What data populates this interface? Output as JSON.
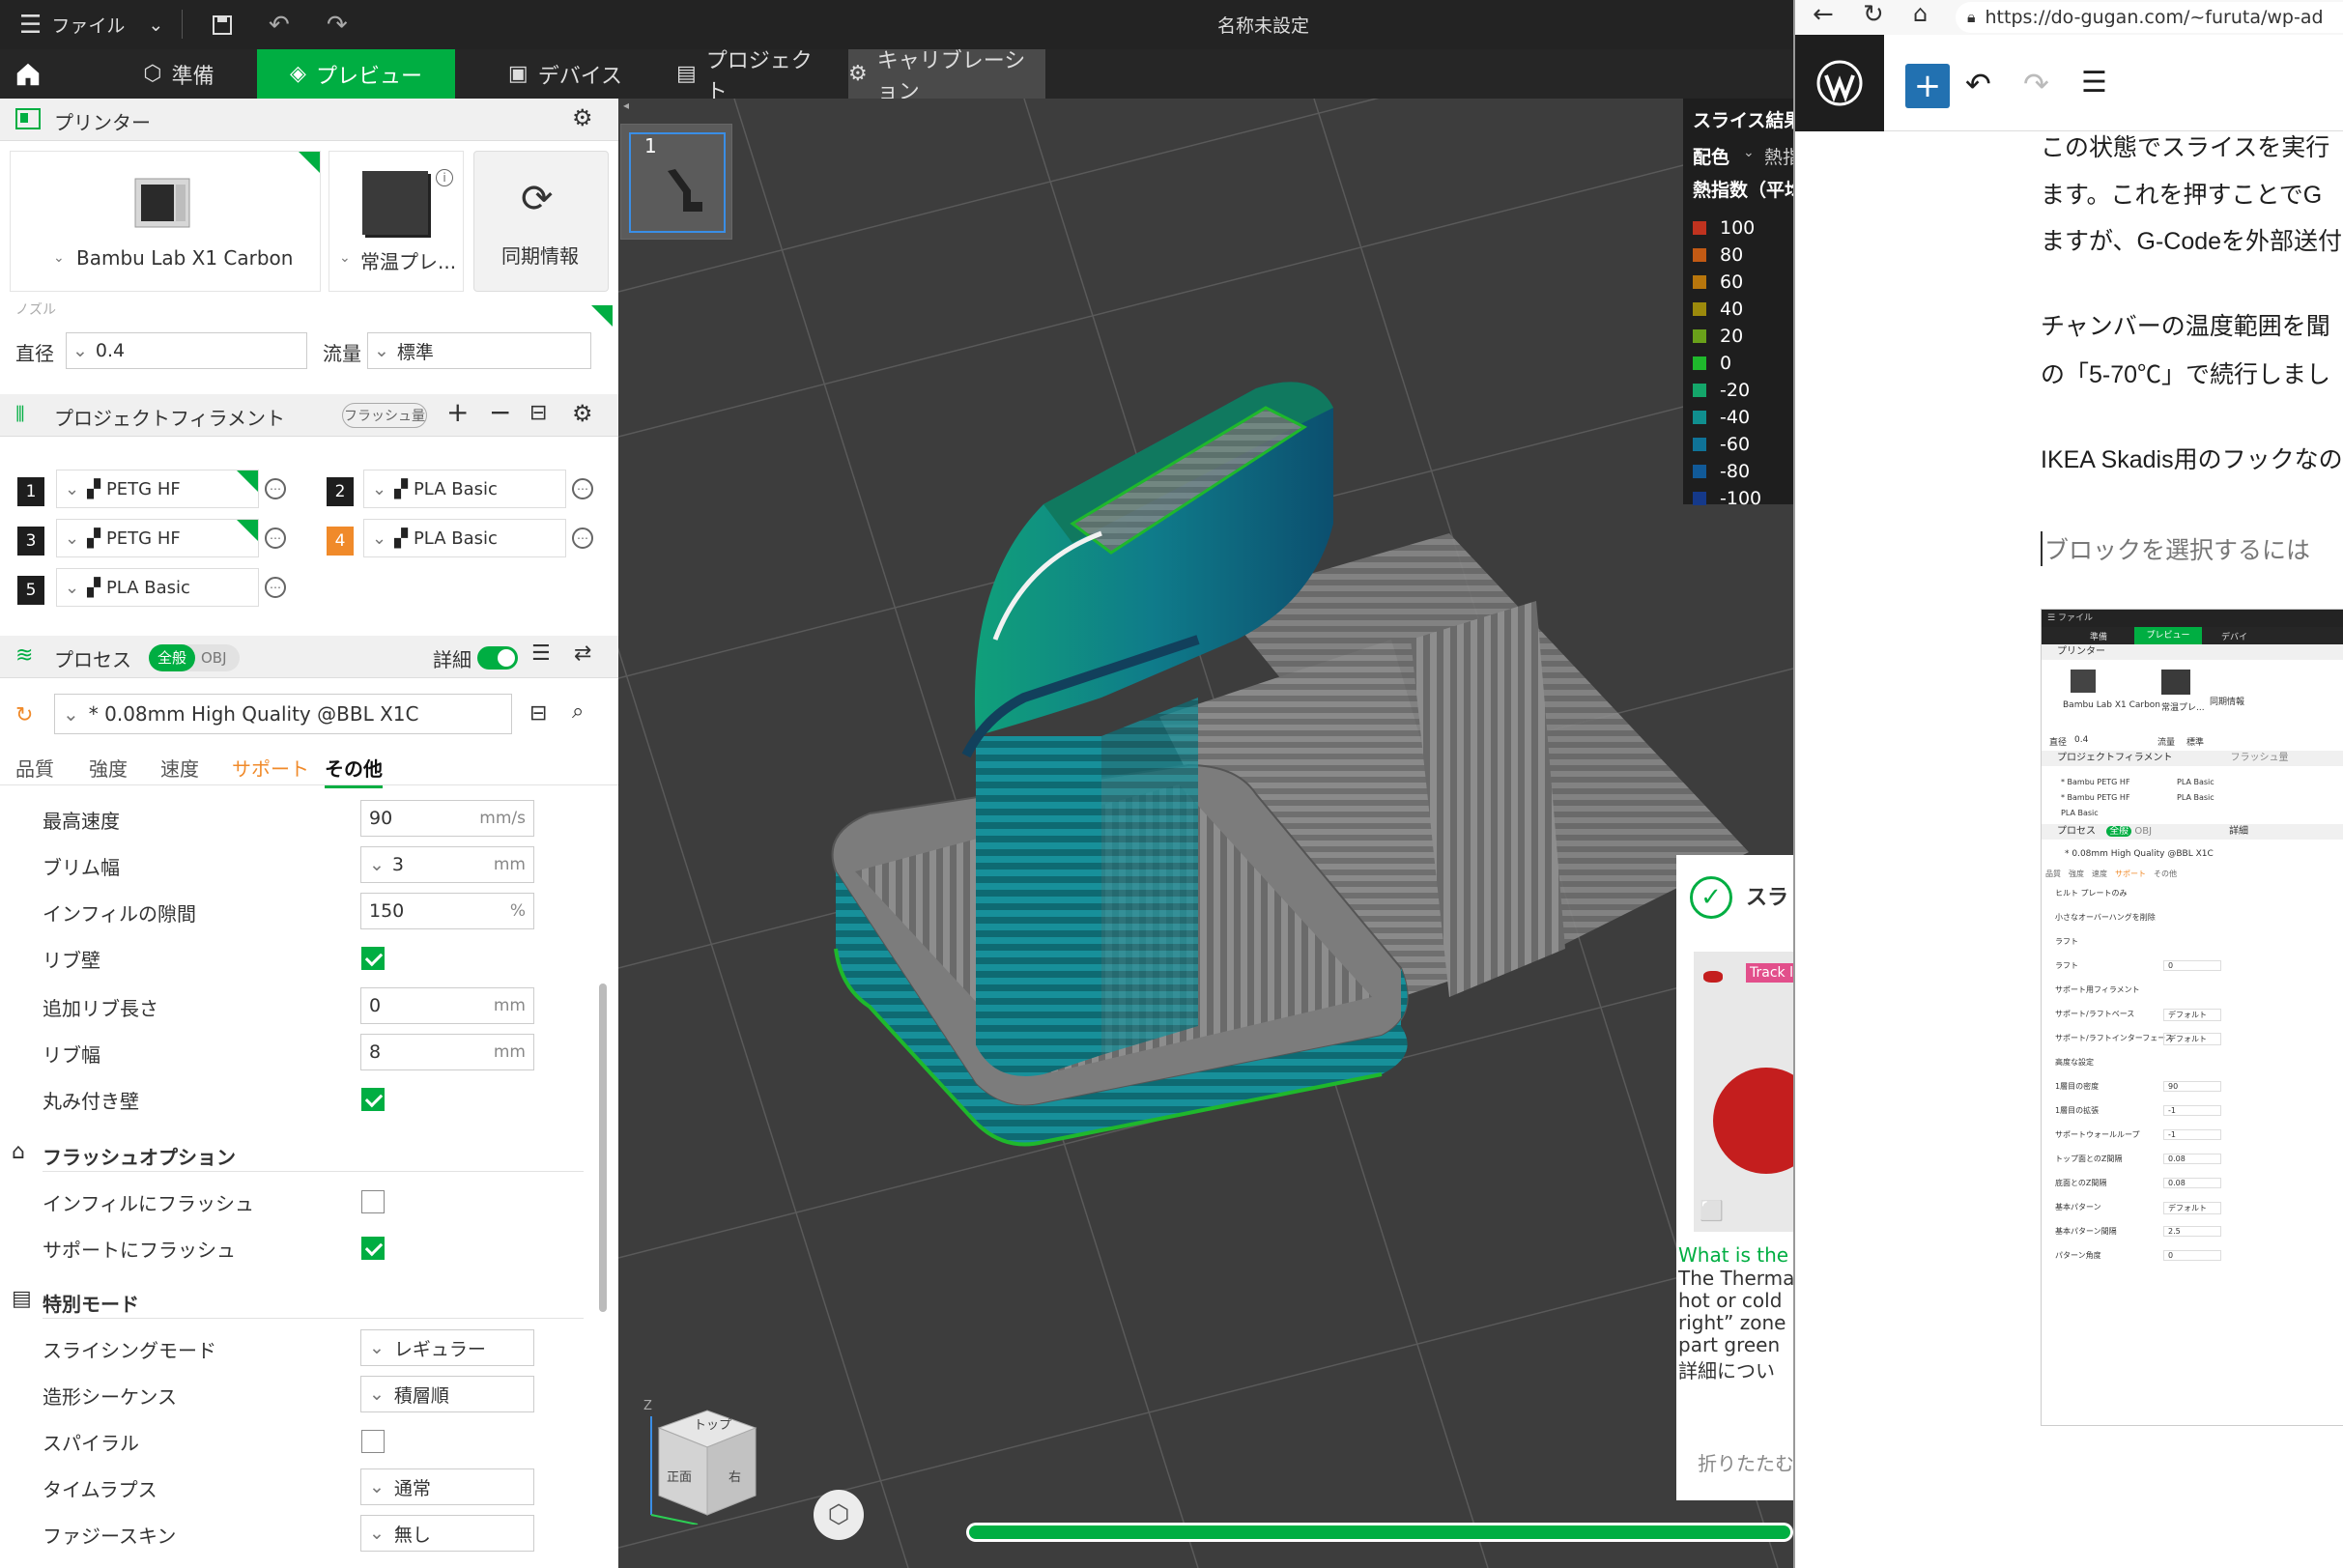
{
  "titlebar": {
    "menu_label": "ファイル",
    "window_title": "名称未設定"
  },
  "tabs": [
    {
      "label": "準備"
    },
    {
      "label": "プレビュー"
    },
    {
      "label": "デバイス"
    },
    {
      "label": "プロジェクト"
    },
    {
      "label": "キャリブレーション"
    }
  ],
  "printer": {
    "section_title": "プリンター",
    "printer_name": "Bambu Lab X1 Carbon",
    "plate_name": "常温プレ...",
    "sync_label": "同期情報",
    "nozzle_group": "ノズル",
    "diameter_label": "直径",
    "diameter_value": "0.4",
    "flow_label": "流量",
    "flow_value": "標準"
  },
  "filament": {
    "section_title": "プロジェクトフィラメント",
    "flush_label": "フラッシュ量",
    "items": [
      {
        "num": "1",
        "name": "PETG HF",
        "color": "#1e1e1e"
      },
      {
        "num": "2",
        "name": "PLA Basic",
        "color": "#1e1e1e"
      },
      {
        "num": "3",
        "name": "PETG HF",
        "color": "#1e1e1e"
      },
      {
        "num": "4",
        "name": "PLA Basic",
        "color": "#f08a2a"
      },
      {
        "num": "5",
        "name": "PLA Basic",
        "color": "#1e1e1e"
      }
    ]
  },
  "process": {
    "section_title": "プロセス",
    "toggle_all": "全般",
    "toggle_obj": "OBJ",
    "detail_label": "詳細",
    "preset": "* 0.08mm High Quality @BBL X1C",
    "subtabs": [
      "品質",
      "強度",
      "速度",
      "サポート",
      "その他"
    ],
    "fields": [
      {
        "label": "最高速度",
        "value": "90",
        "unit": "mm/s"
      },
      {
        "label": "ブリム幅",
        "value": "3",
        "unit": "mm"
      },
      {
        "label": "インフィルの隙間",
        "value": "150",
        "unit": "%"
      },
      {
        "label": "リブ壁"
      },
      {
        "label": "追加リブ長さ",
        "value": "0",
        "unit": "mm"
      },
      {
        "label": "リブ幅",
        "value": "8",
        "unit": "mm"
      },
      {
        "label": "丸み付き壁"
      }
    ],
    "flush_group": "フラッシュオプション",
    "flush_infill": "インフィルにフラッシュ",
    "flush_support": "サポートにフラッシュ",
    "special_group": "特別モード",
    "slicing_mode_label": "スライシングモード",
    "slicing_mode_value": "レギュラー",
    "sequence_label": "造形シーケンス",
    "sequence_value": "積層順",
    "spiral_label": "スパイラル",
    "timelapse_label": "タイムラプス",
    "timelapse_value": "通常",
    "fuzzy_label": "ファジースキン",
    "fuzzy_value": "無し"
  },
  "viewport": {
    "plate_number": "1",
    "cube_top": "トップ",
    "cube_front": "正面",
    "cube_right": "右",
    "axis_z": "Z",
    "progress": 1.0
  },
  "legend": {
    "title": "スライス結果",
    "color_label": "配色",
    "color_value": "熱指数",
    "subtitle": "熱指数（平均",
    "entries": [
      {
        "value": "100",
        "color": "#c0331f"
      },
      {
        "value": "80",
        "color": "#c25a14"
      },
      {
        "value": "60",
        "color": "#b8760c"
      },
      {
        "value": "40",
        "color": "#9c8a0c"
      },
      {
        "value": "20",
        "color": "#6aa11a"
      },
      {
        "value": "0",
        "color": "#1fb82c"
      },
      {
        "value": "-20",
        "color": "#14a66a"
      },
      {
        "value": "-40",
        "color": "#108f8f"
      },
      {
        "value": "-60",
        "color": "#0f7398"
      },
      {
        "value": "-80",
        "color": "#115a98"
      },
      {
        "value": "-100",
        "color": "#15398a"
      }
    ]
  },
  "notification": {
    "title": "スラ",
    "badge": "Track l",
    "what_text": "What is the",
    "body_lines": [
      "The Therma",
      "hot or cold",
      "right” zone",
      "part green",
      "詳細につい"
    ],
    "collapse_label": "折りたたむ"
  },
  "browser": {
    "url": "https://do-gugan.com/~furuta/wp-ad",
    "paragraphs": [
      "この状態でスライスを実行",
      "ます。これを押すことでG",
      "ますが、G-Codeを外部送付",
      "チャンバーの温度範囲を聞",
      "の「5-70℃」で続行しまし",
      "IKEA Skadis用のフックなの"
    ],
    "placeholder": "ブロックを選択するには"
  },
  "thumbnail": {
    "menu": "ファイル",
    "tab_prepare": "準備",
    "tab_preview": "プレビュー",
    "tab_device": "デバイ",
    "printer_section": "プリンター",
    "printer_name": "Bambu Lab X1 Carbon",
    "plate_name": "常温プレ...",
    "sync": "同期情報",
    "diameter": "直径",
    "diameter_value": "0.4",
    "flow": "流量",
    "flow_value": "標準",
    "filament_section": "プロジェクトフィラメント",
    "flush": "フラッシュ量",
    "fil1": "* Bambu PETG HF",
    "fil2": "PLA Basic",
    "fil3": "* Bambu PETG HF",
    "fil4": "PLA Basic",
    "fil5": "PLA Basic",
    "process_section": "プロセス",
    "all": "全般",
    "obj": "OBJ",
    "detail": "詳細",
    "preset": "* 0.08mm High Quality @BBL X1C",
    "subtabs": [
      "品質",
      "強度",
      "速度",
      "サポート",
      "その他"
    ],
    "rows": [
      {
        "label": "ヒルト プレートのみ",
        "value": ""
      },
      {
        "label": "小さなオーバーハングを削除",
        "value": ""
      },
      {
        "label": "ラフト",
        "value": ""
      },
      {
        "label": "ラフト",
        "value": "0"
      },
      {
        "label": "サポート用フィラメント",
        "value": ""
      },
      {
        "label": "サポート/ラフトベース",
        "value": "デフォルト"
      },
      {
        "label": "サポート/ラフトインターフェース",
        "value": "デフォルト"
      },
      {
        "label": "高度な設定",
        "value": ""
      },
      {
        "label": "1層目の密度",
        "value": "90"
      },
      {
        "label": "1層目の拡張",
        "value": "-1"
      },
      {
        "label": "サポートウォールループ",
        "value": "-1"
      },
      {
        "label": "トップ面とのZ間隔",
        "value": "0.08"
      },
      {
        "label": "底面とのZ間隔",
        "value": "0.08"
      },
      {
        "label": "基本パターン",
        "value": "デフォルト"
      },
      {
        "label": "基本パターン間隔",
        "value": "2.5"
      },
      {
        "label": "パターン角度",
        "value": "0"
      }
    ]
  },
  "colors": {
    "accent": "#00ae42",
    "toolbar_dark": "#232323",
    "wp_blue": "#2271b1"
  }
}
